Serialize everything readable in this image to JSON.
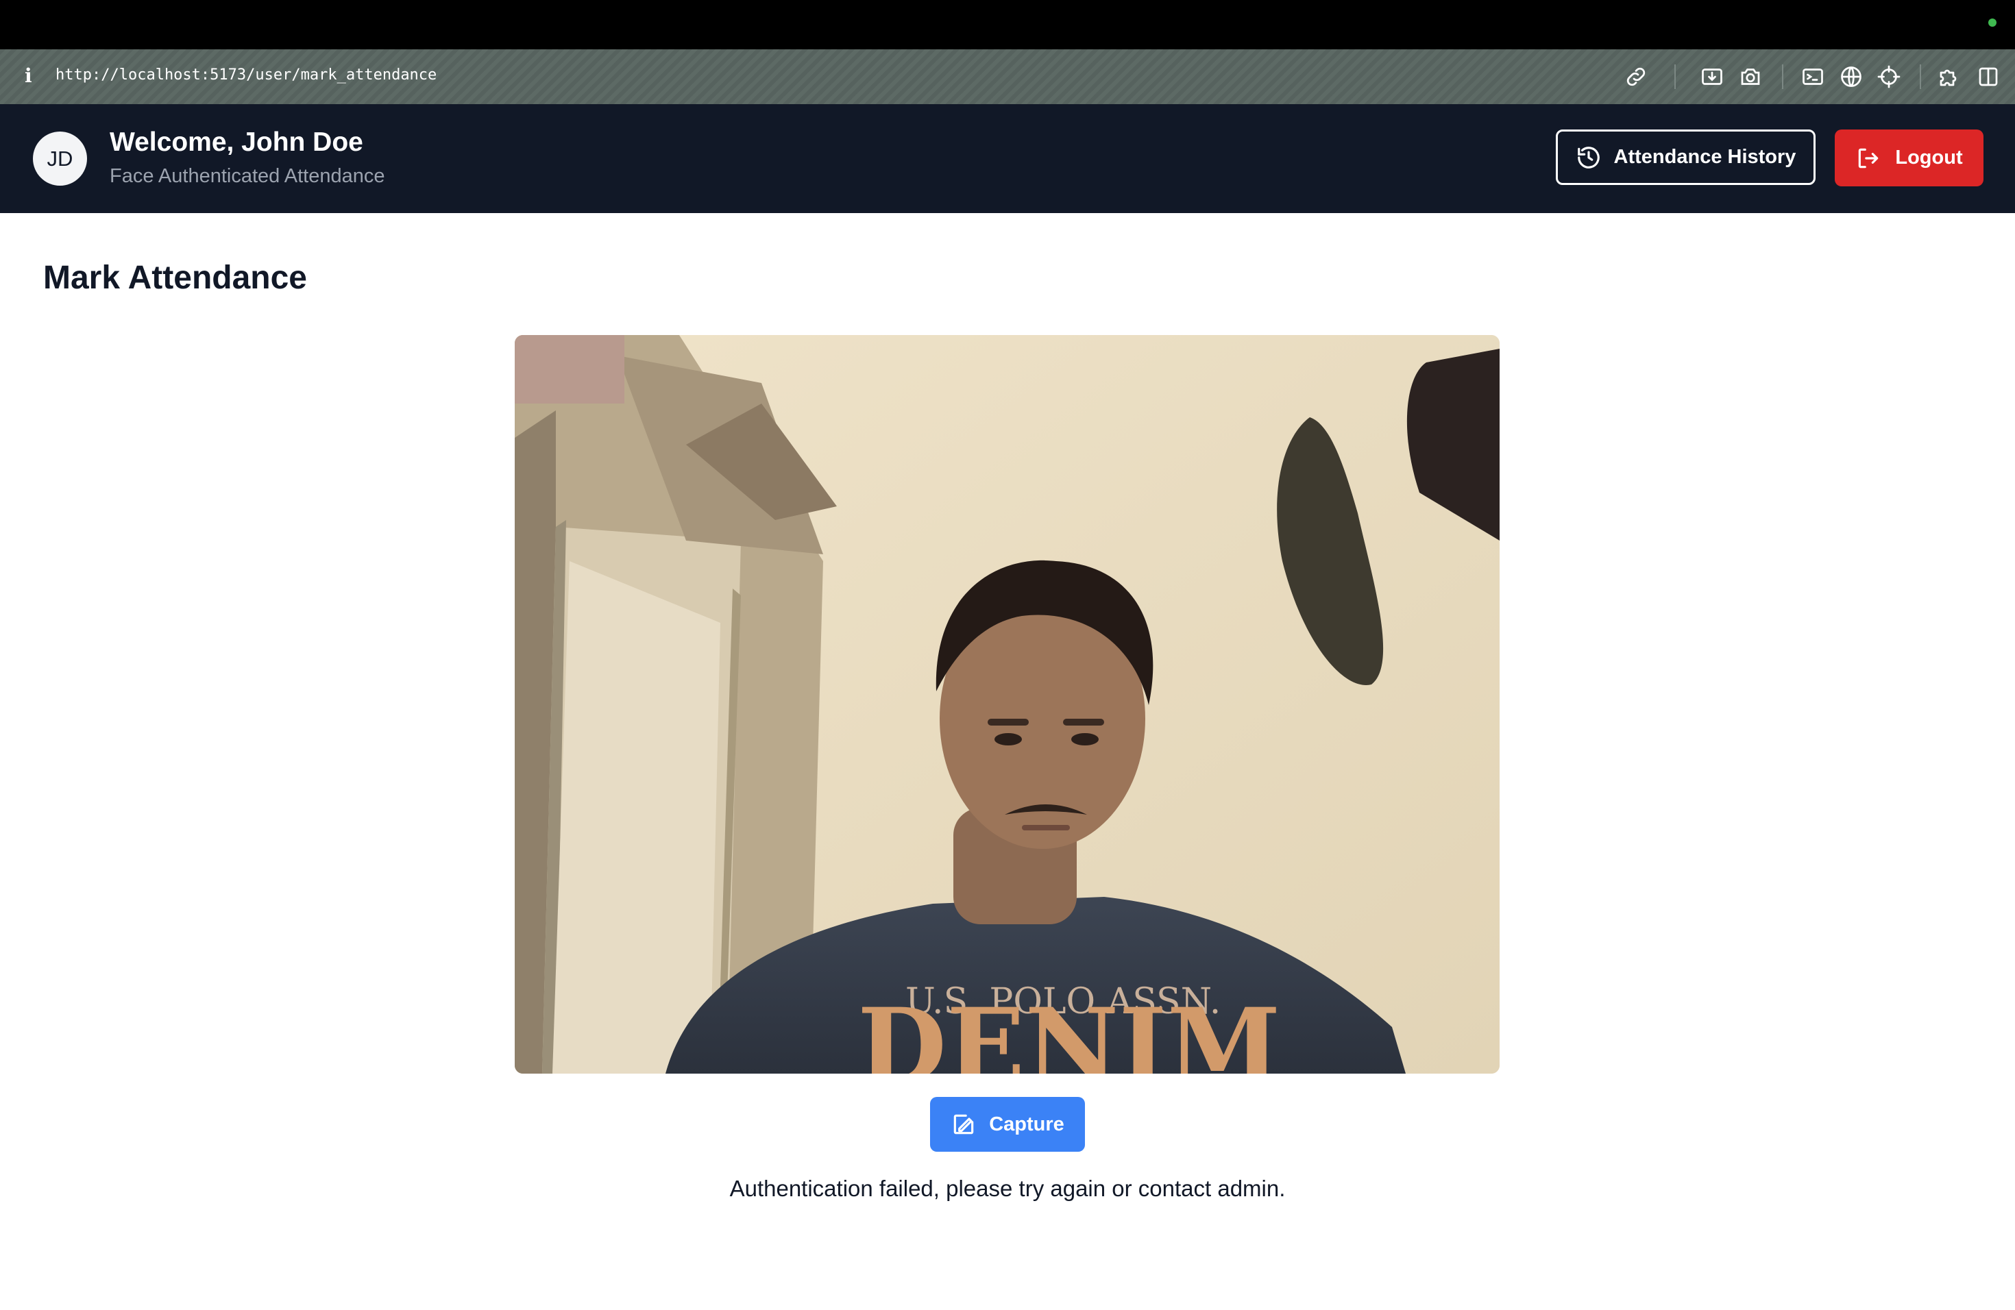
{
  "browser": {
    "url": "http://localhost:5173/user/mark_attendance",
    "info_icon": "info-icon",
    "tools": [
      "link-icon",
      "download-icon",
      "camera-icon",
      "terminal-icon",
      "globe-icon",
      "crosshair-icon",
      "extension-icon",
      "sidebar-icon"
    ]
  },
  "header": {
    "avatar_initials": "JD",
    "welcome": "Welcome, John Doe",
    "subtitle": "Face Authenticated Attendance",
    "history_label": "Attendance History",
    "history_icon": "history-icon",
    "logout_label": "Logout",
    "logout_icon": "logout-icon"
  },
  "main": {
    "title": "Mark Attendance",
    "camera_feed": "webcam-feed",
    "capture_label": "Capture",
    "capture_icon": "capture-icon",
    "status_message": "Authentication failed, please try again or contact admin."
  },
  "colors": {
    "header_bg": "#111827",
    "logout_bg": "#dc2626",
    "capture_bg": "#3b82f6"
  }
}
